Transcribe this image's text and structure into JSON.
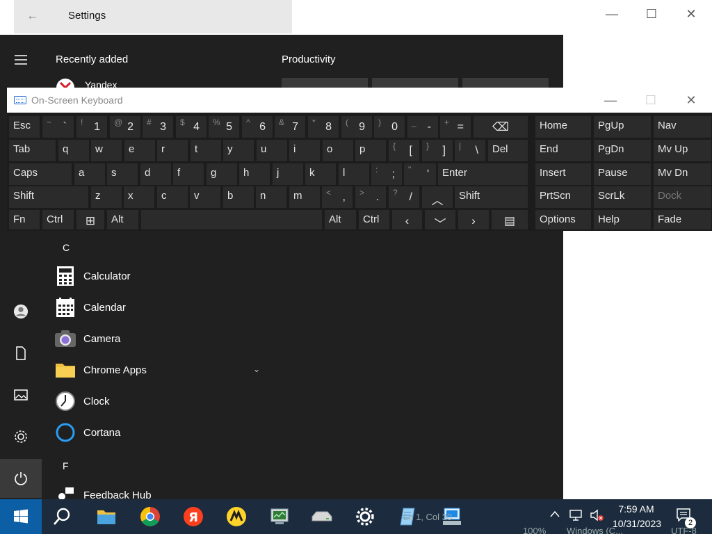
{
  "settings_window": {
    "title": "Settings",
    "back_glyph": "←",
    "minimize_glyph": "—",
    "maximize_glyph": "☐",
    "close_glyph": "✕"
  },
  "start_menu": {
    "recent_label": "Recently added",
    "productivity_label": "Productivity",
    "partial_app": "Yandex",
    "letters": {
      "c": "C",
      "f": "F"
    },
    "apps": [
      {
        "label": "Calculator",
        "icon": "calculator-icon"
      },
      {
        "label": "Calendar",
        "icon": "calendar-icon"
      },
      {
        "label": "Camera",
        "icon": "camera-icon"
      },
      {
        "label": "Chrome Apps",
        "icon": "folder-icon",
        "expandable": true
      },
      {
        "label": "Clock",
        "icon": "clock-icon"
      },
      {
        "label": "Cortana",
        "icon": "cortana-icon"
      },
      {
        "label": "Feedback Hub",
        "icon": "feedback-hub-icon"
      }
    ],
    "chevron_glyph": "⌄"
  },
  "osk": {
    "title": "On-Screen Keyboard",
    "minimize_glyph": "—",
    "maximize_glyph": "☐",
    "close_glyph": "✕",
    "row1": [
      {
        "name": "esc",
        "main": "Esc"
      },
      {
        "name": "tilde",
        "shift": "~",
        "base": "`"
      },
      {
        "name": "1",
        "shift": "!",
        "base": "1"
      },
      {
        "name": "2",
        "shift": "@",
        "base": "2"
      },
      {
        "name": "3",
        "shift": "#",
        "base": "3"
      },
      {
        "name": "4",
        "shift": "$",
        "base": "4"
      },
      {
        "name": "5",
        "shift": "%",
        "base": "5"
      },
      {
        "name": "6",
        "shift": "^",
        "base": "6"
      },
      {
        "name": "7",
        "shift": "&",
        "base": "7"
      },
      {
        "name": "8",
        "shift": "*",
        "base": "8"
      },
      {
        "name": "9",
        "shift": "(",
        "base": "9"
      },
      {
        "name": "0",
        "shift": ")",
        "base": "0"
      },
      {
        "name": "minus",
        "shift": "_",
        "base": "-"
      },
      {
        "name": "equals",
        "shift": "+",
        "base": "="
      },
      {
        "name": "backspace",
        "center": "⌫"
      }
    ],
    "row2": [
      {
        "name": "tab",
        "main": "Tab"
      },
      {
        "name": "q",
        "main": "q"
      },
      {
        "name": "w",
        "main": "w"
      },
      {
        "name": "e",
        "main": "e"
      },
      {
        "name": "r",
        "main": "r"
      },
      {
        "name": "t",
        "main": "t"
      },
      {
        "name": "y",
        "main": "y"
      },
      {
        "name": "u",
        "main": "u"
      },
      {
        "name": "i",
        "main": "i"
      },
      {
        "name": "o",
        "main": "o"
      },
      {
        "name": "p",
        "main": "p"
      },
      {
        "name": "lbracket",
        "shift": "{",
        "base": "["
      },
      {
        "name": "rbracket",
        "shift": "}",
        "base": "]"
      },
      {
        "name": "backslash",
        "shift": "|",
        "base": "\\"
      },
      {
        "name": "del",
        "main": "Del"
      }
    ],
    "row3": [
      {
        "name": "caps",
        "main": "Caps"
      },
      {
        "name": "a",
        "main": "a"
      },
      {
        "name": "s",
        "main": "s"
      },
      {
        "name": "d",
        "main": "d"
      },
      {
        "name": "f",
        "main": "f"
      },
      {
        "name": "g",
        "main": "g"
      },
      {
        "name": "h",
        "main": "h"
      },
      {
        "name": "j",
        "main": "j"
      },
      {
        "name": "k",
        "main": "k"
      },
      {
        "name": "l",
        "main": "l"
      },
      {
        "name": "semicolon",
        "shift": ":",
        "base": ";"
      },
      {
        "name": "quote",
        "shift": "\"",
        "base": "'"
      },
      {
        "name": "enter",
        "main": "Enter"
      }
    ],
    "row4": [
      {
        "name": "lshift",
        "main": "Shift"
      },
      {
        "name": "z",
        "main": "z"
      },
      {
        "name": "x",
        "main": "x"
      },
      {
        "name": "c",
        "main": "c"
      },
      {
        "name": "v",
        "main": "v"
      },
      {
        "name": "b",
        "main": "b"
      },
      {
        "name": "n",
        "main": "n"
      },
      {
        "name": "m",
        "main": "m"
      },
      {
        "name": "comma",
        "shift": "<",
        "base": ","
      },
      {
        "name": "period",
        "shift": ">",
        "base": "."
      },
      {
        "name": "slash",
        "shift": "?",
        "base": "/"
      },
      {
        "name": "up",
        "center": "︿"
      },
      {
        "name": "rshift",
        "main": "Shift"
      }
    ],
    "row5": [
      {
        "name": "fn",
        "main": "Fn"
      },
      {
        "name": "ctrl-left",
        "main": "Ctrl"
      },
      {
        "name": "win",
        "center": "⊞"
      },
      {
        "name": "alt-left",
        "main": "Alt"
      },
      {
        "name": "space",
        "main": ""
      },
      {
        "name": "alt-right",
        "main": "Alt"
      },
      {
        "name": "ctrl-right",
        "main": "Ctrl"
      },
      {
        "name": "left",
        "center": "‹"
      },
      {
        "name": "down",
        "center": "﹀"
      },
      {
        "name": "right",
        "center": "›"
      },
      {
        "name": "menu",
        "center": "▤"
      }
    ],
    "nav": [
      [
        "Home",
        "PgUp",
        "Nav"
      ],
      [
        "End",
        "PgDn",
        "Mv Up"
      ],
      [
        "Insert",
        "Pause",
        "Mv Dn"
      ],
      [
        "PrtScn",
        "ScrLk",
        "Dock"
      ],
      [
        "Options",
        "Help",
        "Fade"
      ]
    ]
  },
  "taskbar": {
    "time": "7:59 AM",
    "date": "10/31/2023",
    "notification_count": "2",
    "behind_texts": [
      "100%",
      "Windows (C...",
      "UTF-8"
    ],
    "partial_status": "Ln 1, Col 30",
    "icons": [
      "search-icon",
      "file-explorer-icon",
      "chrome-icon",
      "yandex-browser-icon",
      "yandex-market-icon",
      "system-monitor-icon",
      "drive-icon",
      "settings-icon",
      "notepad-icon",
      "remote-desktop-icon"
    ]
  }
}
